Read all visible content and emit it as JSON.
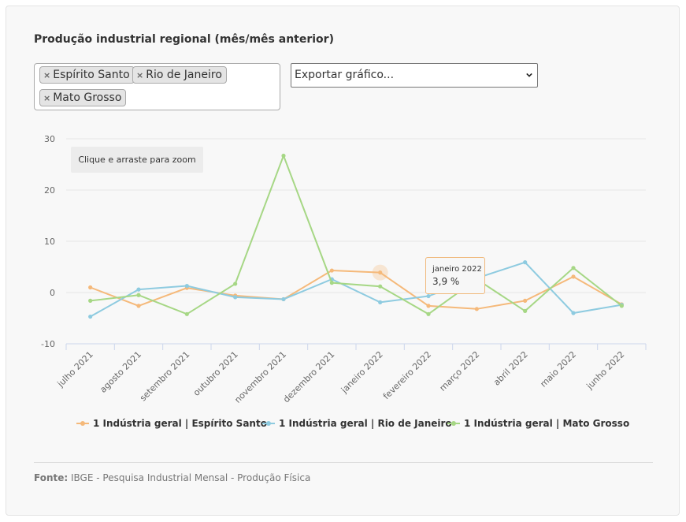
{
  "title": "Produção industrial regional (mês/mês anterior)",
  "filter": {
    "tags": [
      "Espírito Santo",
      "Rio de Janeiro",
      "Mato Grosso"
    ],
    "remove_glyph": "×"
  },
  "export": {
    "selected": "Exportar gráfico..."
  },
  "zoom_hint": "Clique e arraste para zoom",
  "tooltip": {
    "category": "janeiro 2022",
    "value": "3,9 %"
  },
  "source": {
    "label": "Fonte:",
    "text": "IBGE - Pesquisa Industrial Mensal - Produção Física"
  },
  "chart_data": {
    "type": "line",
    "categories": [
      "julho 2021",
      "agosto 2021",
      "setembro 2021",
      "outubro 2021",
      "novembro 2021",
      "dezembro 2021",
      "janeiro 2022",
      "fevereiro 2022",
      "março 2022",
      "abril 2022",
      "maio 2022",
      "junho 2022"
    ],
    "ylim": [
      -10,
      30
    ],
    "yticks": [
      "-10",
      "0",
      "10",
      "20",
      "30"
    ],
    "ytick_values": [
      -10,
      0,
      10,
      20,
      30
    ],
    "grid": true,
    "legend_position": "bottom",
    "series": [
      {
        "name": "1 Indústria geral | Espírito Santo",
        "color": "#f5b97a",
        "values": [
          1.0,
          -2.6,
          0.9,
          -0.6,
          -1.3,
          4.3,
          3.9,
          -2.6,
          -3.2,
          -1.6,
          3.1,
          -2.3
        ]
      },
      {
        "name": "1 Indústria geral | Rio de Janeiro",
        "color": "#8ecbe0",
        "values": [
          -4.7,
          0.6,
          1.3,
          -0.9,
          -1.3,
          2.6,
          -1.9,
          -0.7,
          2.8,
          5.9,
          -4.0,
          -2.4
        ]
      },
      {
        "name": "1 Indústria geral | Mato Grosso",
        "color": "#a6d785",
        "values": [
          -1.6,
          -0.5,
          -4.2,
          1.7,
          26.7,
          1.9,
          1.2,
          -4.2,
          2.6,
          -3.6,
          4.8,
          -2.6
        ]
      }
    ]
  }
}
